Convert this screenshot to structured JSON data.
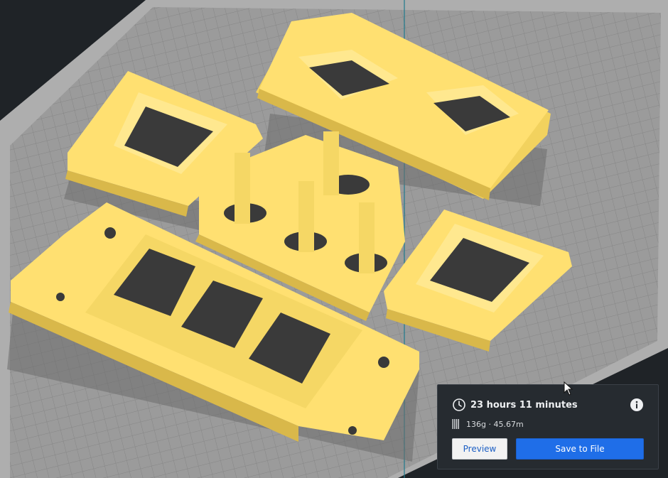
{
  "print_summary": {
    "time": "23 hours 11 minutes",
    "material": "136g · 45.67m"
  },
  "actions": {
    "preview_label": "Preview",
    "save_label": "Save to File"
  },
  "icons": {
    "time": "clock-icon",
    "info": "info-icon",
    "material": "filament-spool-icon",
    "pointer": "mouse-cursor-icon"
  },
  "colors": {
    "model_yellow": "#ffe071",
    "build_plate": "#9a9a9a",
    "background": "#1f2327",
    "primary_button": "#1f6ee8"
  }
}
